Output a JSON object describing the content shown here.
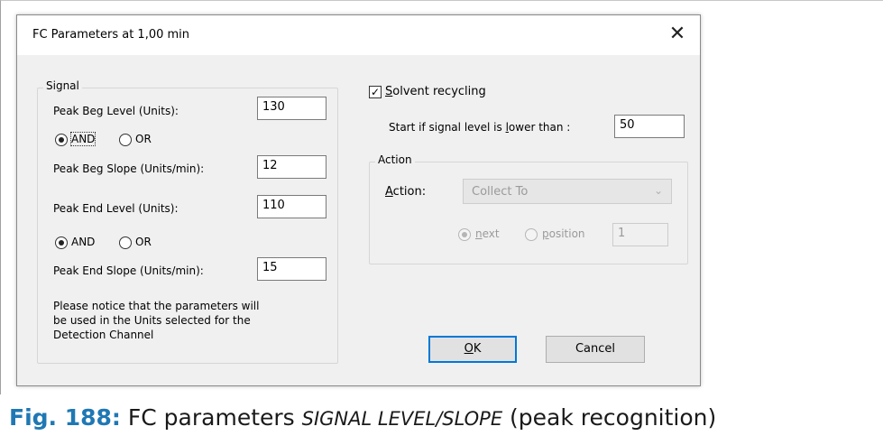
{
  "dialog": {
    "title": "FC Parameters at 1,00 min",
    "close_glyph": "✕"
  },
  "signal": {
    "group_label": "Signal",
    "peak_beg_level_label": "Peak Beg Level (Units):",
    "peak_beg_level_value": "130",
    "logic1": {
      "and_label": "AND",
      "or_label": "OR",
      "selected": "AND"
    },
    "peak_beg_slope_label": "Peak Beg Slope (Units/min):",
    "peak_beg_slope_value": "12",
    "peak_end_level_label": "Peak End Level (Units):",
    "peak_end_level_value": "110",
    "logic2": {
      "and_label": "AND",
      "or_label": "OR",
      "selected": "AND"
    },
    "peak_end_slope_label": "Peak End Slope (Units/min):",
    "peak_end_slope_value": "15",
    "notice_line1": "Please notice that the parameters will",
    "notice_line2": "be used in the Units selected for the",
    "notice_line3": "Detection Channel"
  },
  "recycling": {
    "checkbox_label_first": "S",
    "checkbox_label_rest": "olvent recycling",
    "checked": true,
    "check_glyph": "✓",
    "start_label_a": "Start if signal level is ",
    "start_label_u": "l",
    "start_label_b": "ower than :",
    "start_value": "50"
  },
  "action": {
    "group_label": "Action",
    "action_label_first": "A",
    "action_label_rest": "ction:",
    "combo_value": "Collect To",
    "combo_arrow": "⌄",
    "next_first": "n",
    "next_rest": "ext",
    "position_first": "p",
    "position_rest": "osition",
    "position_value": "1",
    "selected": "next"
  },
  "buttons": {
    "ok_first": "O",
    "ok_rest": "K",
    "cancel": "Cancel"
  },
  "caption": {
    "number": "Fig. 188:",
    "text": "FC parameters ",
    "italic": "SIGNAL LEVEL/SLOPE",
    "suffix": " (peak recognition)"
  }
}
